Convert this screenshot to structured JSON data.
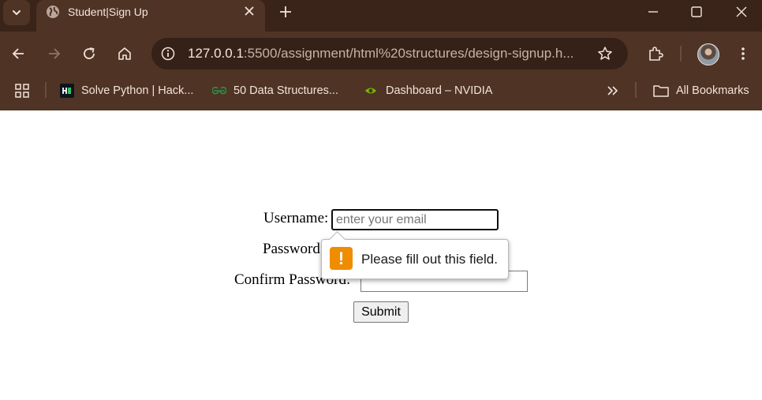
{
  "browser": {
    "tab": {
      "title": "Student|Sign Up"
    },
    "address": {
      "url_host": "127.0.0.1",
      "url_rest": ":5500/assignment/html%20structures/design-signup.h..."
    },
    "bookmarks": [
      {
        "label": "Solve Python | Hack..."
      },
      {
        "label": "50 Data Structures..."
      },
      {
        "label": "Dashboard – NVIDIA"
      }
    ],
    "all_bookmarks_label": "All Bookmarks",
    "colors": {
      "frame": "#3a2419",
      "toolbar": "#4f3325",
      "omnibox": "#352117"
    }
  },
  "form": {
    "username_label": "Username:",
    "username_placeholder": "enter your email",
    "password_label": "Password:",
    "confirm_label": "Confirm Password:",
    "submit_label": "Submit"
  },
  "validation": {
    "message": "Please fill out this field.",
    "icon": "!",
    "color": "#f08c00"
  }
}
